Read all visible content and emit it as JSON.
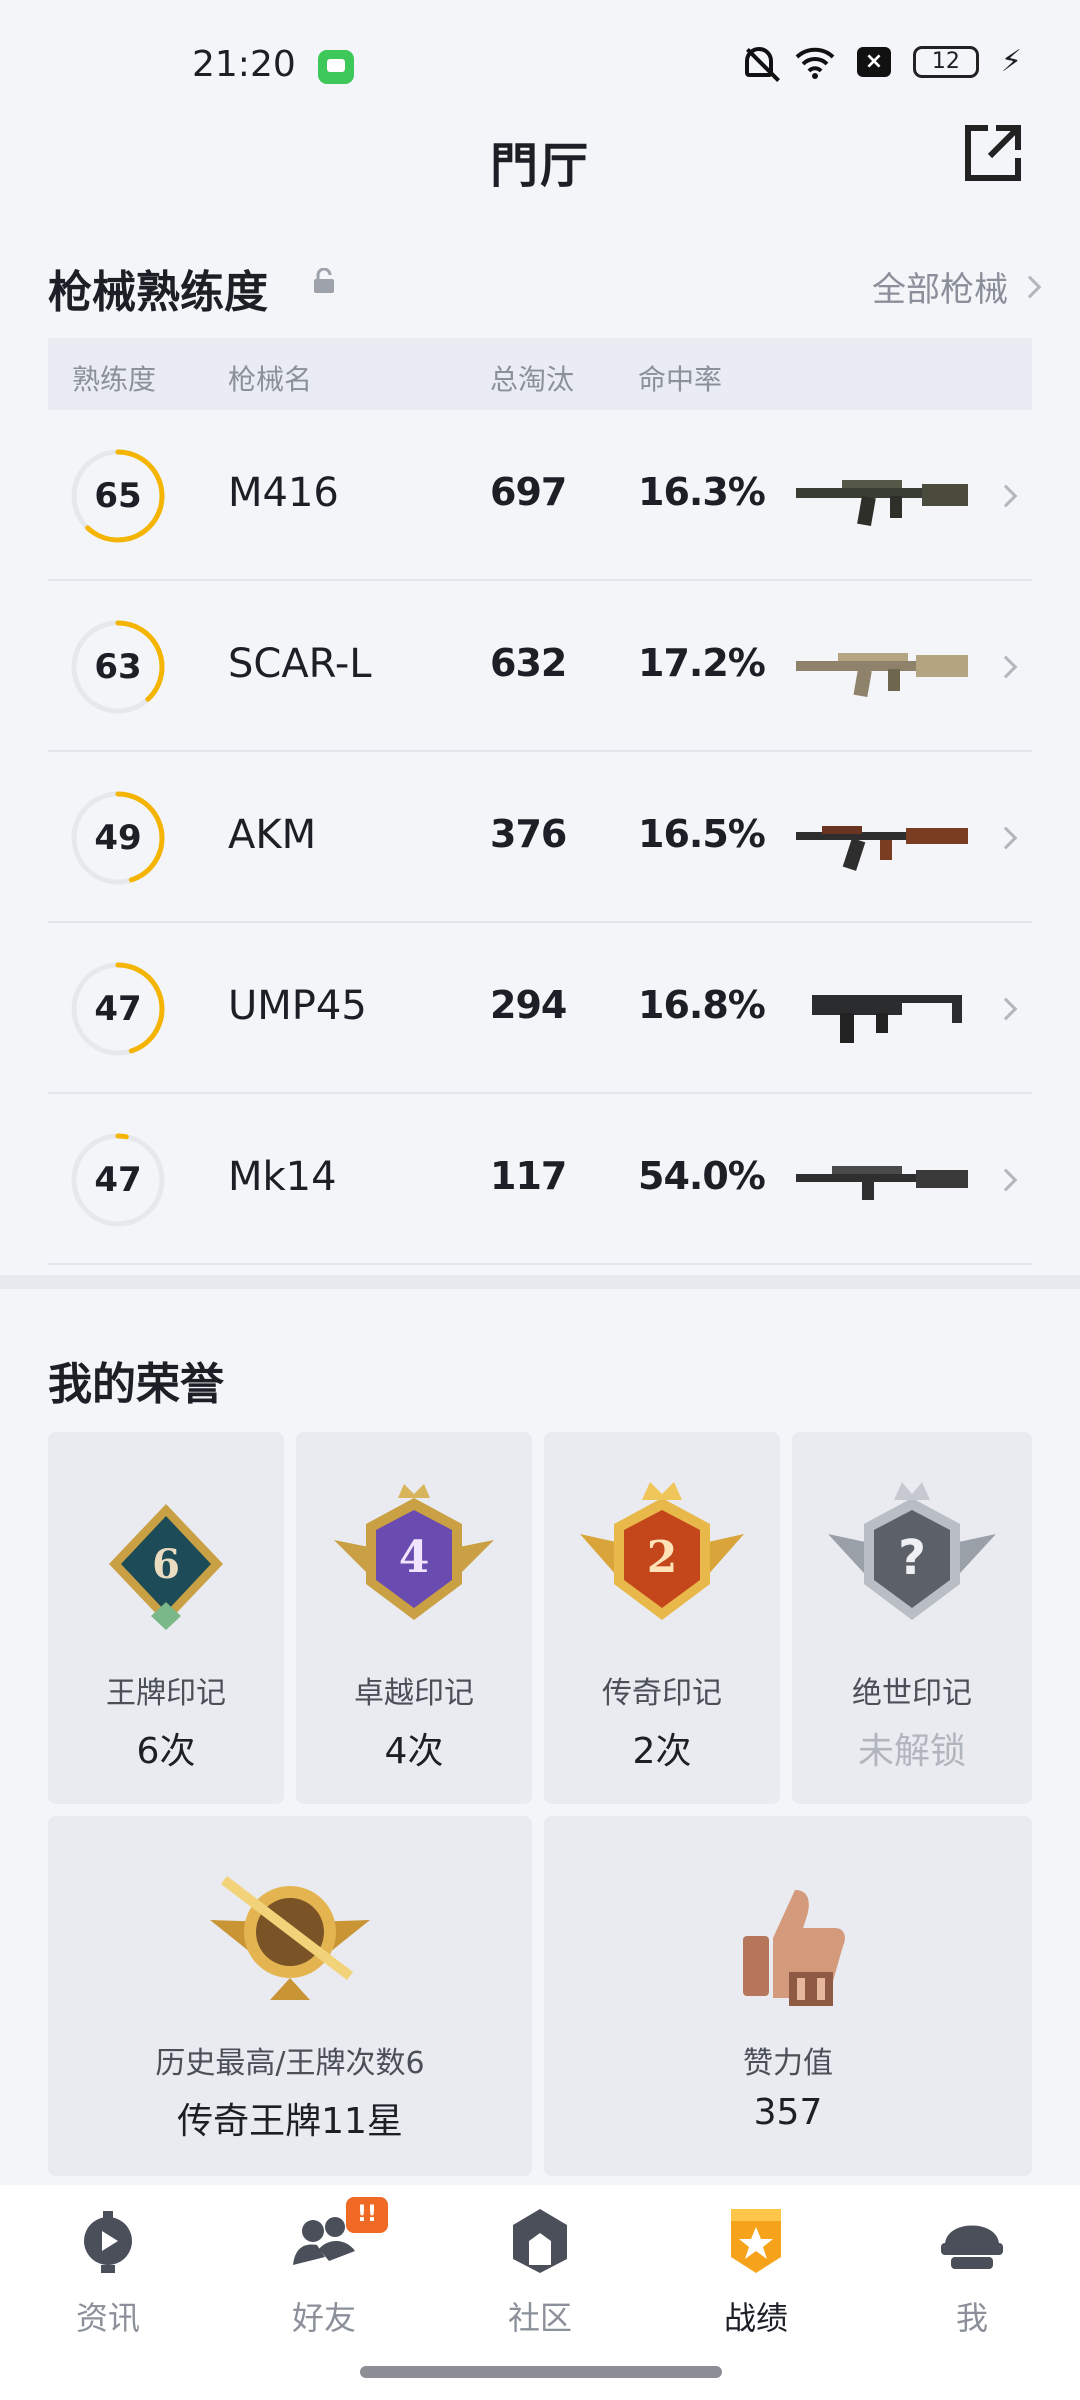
{
  "status_bar": {
    "time": "21:20",
    "battery": "12"
  },
  "header": {
    "title": "門厅"
  },
  "weapons": {
    "title": "枪械熟练度",
    "all_link": "全部枪械",
    "columns": [
      "熟练度",
      "枪械名",
      "总淘汰",
      "命中率"
    ],
    "rows": [
      {
        "level": "65",
        "name": "M416",
        "kills": "697",
        "accuracy": "16.3%",
        "progress": 0.62
      },
      {
        "level": "63",
        "name": "SCAR-L",
        "kills": "632",
        "accuracy": "17.2%",
        "progress": 0.38
      },
      {
        "level": "49",
        "name": "AKM",
        "kills": "376",
        "accuracy": "16.5%",
        "progress": 0.45
      },
      {
        "level": "47",
        "name": "UMP45",
        "kills": "294",
        "accuracy": "16.8%",
        "progress": 0.45
      },
      {
        "level": "47",
        "name": "Mk14",
        "kills": "117",
        "accuracy": "54.0%",
        "progress": 0.03
      }
    ]
  },
  "honors": {
    "title": "我的荣誉",
    "marks": [
      {
        "label": "王牌印记",
        "value": "6次",
        "badge_number": "6"
      },
      {
        "label": "卓越印记",
        "value": "4次",
        "badge_number": "4"
      },
      {
        "label": "传奇印记",
        "value": "2次",
        "badge_number": "2"
      },
      {
        "label": "绝世印记",
        "value": "未解锁",
        "badge_number": "?"
      }
    ],
    "highest": {
      "label": "历史最高/王牌次数6",
      "value": "传奇王牌11星"
    },
    "likes": {
      "label": "赞力值",
      "value": "357"
    }
  },
  "bottom_nav": {
    "items": [
      {
        "label": "资讯",
        "icon": "news-icon"
      },
      {
        "label": "好友",
        "icon": "friends-icon"
      },
      {
        "label": "社区",
        "icon": "community-icon"
      },
      {
        "label": "战绩",
        "icon": "record-icon"
      },
      {
        "label": "我",
        "icon": "me-icon"
      }
    ],
    "friends_badge": "!!"
  },
  "colors": {
    "accent": "#f4b400",
    "active_nav": "#f4a21b"
  }
}
